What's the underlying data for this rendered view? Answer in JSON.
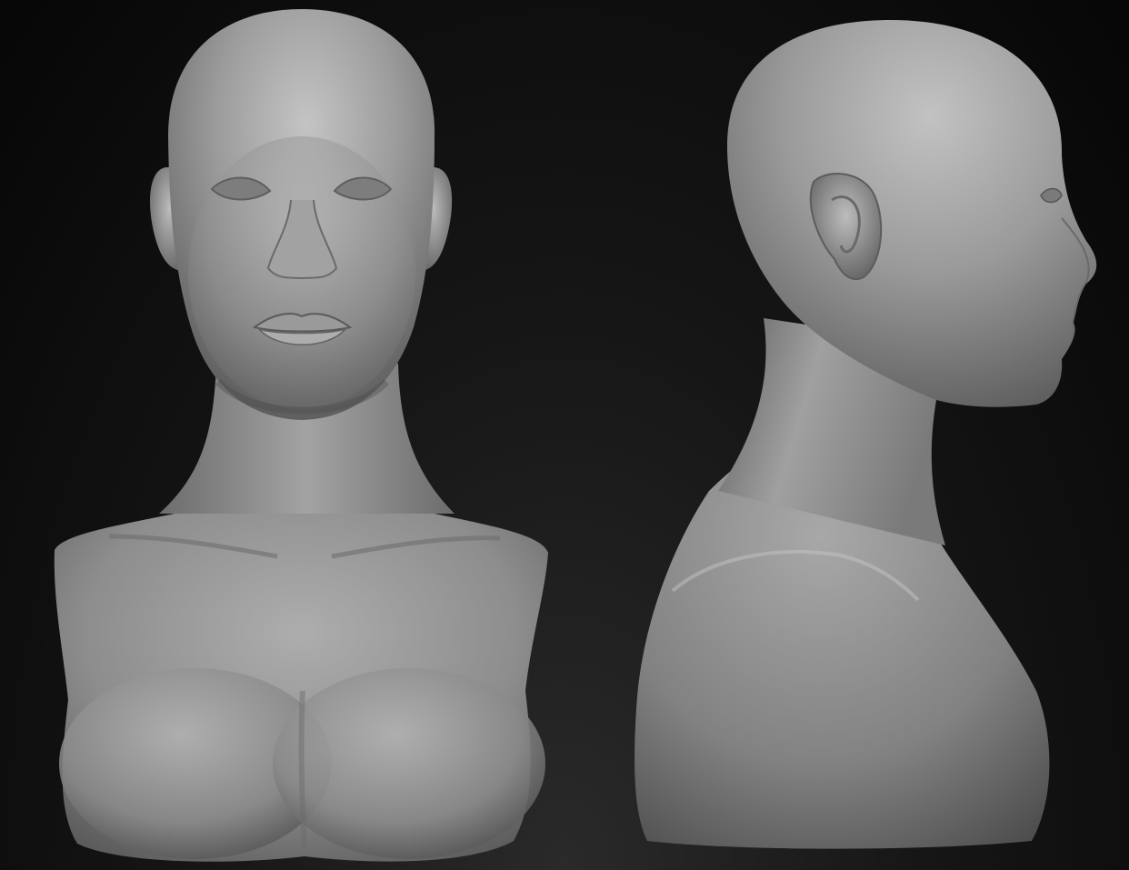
{
  "scene": {
    "subject": "",
    "views": [
      {
        "id": "front"
      },
      {
        "id": "side"
      }
    ]
  },
  "colors": {
    "background_top": "#060606",
    "background_bottom": "#2a2a2a",
    "clay_light": "#b9b9b9",
    "clay_mid": "#8e8e8e",
    "clay_dark": "#545454",
    "clay_shadow": "#3a3a3a"
  }
}
